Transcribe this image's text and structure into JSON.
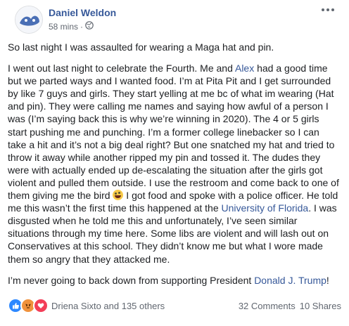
{
  "post": {
    "author": "Daniel Weldon",
    "time": "58 mins",
    "separator": "·",
    "lead": "So last night I was assaulted for wearing a Maga hat and pin.",
    "p1": {
      "t1": "I went out last night to celebrate the Fourth. Me and ",
      "alex": "Alex",
      "t2": " had a good time but we parted ways and I wanted food. I’m at Pita Pit and I get surrounded by like 7 guys and girls. They start yelling at me bc of what im wearing (Hat and pin). They were calling me names and saying how awful of a person I was (I’m saying back this is why we’re winning in 2020). The 4 or 5 girls start pushing me and punching. I’m a former college linebacker so I can take a hit and it’s not a big deal right? But one snatched my hat and tried to throw it away while another ripped my pin and tossed it. The dudes they were with actually ended up de-escalating the situation after the girls got violent and pulled them outside. I use the restroom and come back to one of them giving me the bird ",
      "t3": " I got food and spoke with a police officer. He told me this wasn’t the first time this happened at the ",
      "uf": "University of Florida",
      "t4": ". I was disgusted when he told me this and unfortunately, I’ve seen similar situations through my time here. Some libs are violent and will lash out on Conservatives at this school. They didn’t know me but what I wore made them so angry that they attacked me."
    },
    "p2": {
      "t1": "I’m never going to back down from supporting President ",
      "trump": "Donald J. Trump",
      "t2": "!"
    }
  },
  "footer": {
    "reactions_text": "Driena Sixto and 135 others",
    "comments": "32 Comments",
    "shares": "10 Shares"
  },
  "icons": [
    "avatar",
    "globe-icon",
    "more-options-icon",
    "laughing-emoji-icon",
    "like-reaction-icon",
    "angry-reaction-icon",
    "love-reaction-icon"
  ],
  "colors": {
    "link": "#365899",
    "text": "#1c1e21",
    "meta": "#616770",
    "like": "#2d88ff",
    "angry": "#f0923c",
    "love": "#f33e58"
  }
}
